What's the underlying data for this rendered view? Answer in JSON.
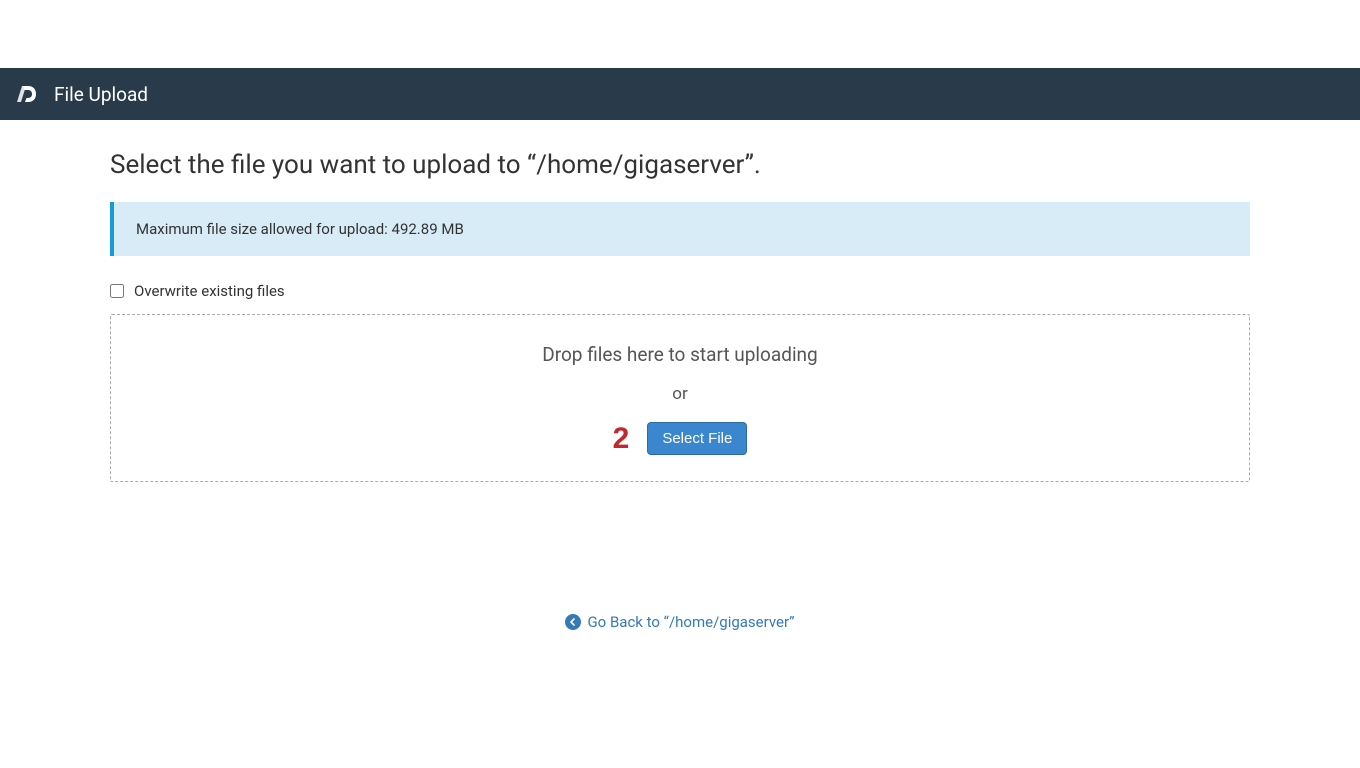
{
  "header": {
    "title": "File Upload"
  },
  "main": {
    "heading": "Select the file you want to upload to “/home/gigaserver”.",
    "info_banner": "Maximum file size allowed for upload: 492.89 MB",
    "overwrite_label": "Overwrite existing files",
    "overwrite_checked": false,
    "dropzone": {
      "drop_text": "Drop files here to start uploading",
      "or_text": "or",
      "step_marker": "2",
      "select_button": "Select File"
    },
    "go_back_label": "Go Back to “/home/gigaserver”"
  },
  "colors": {
    "header_bg": "#293a4a",
    "info_bg": "#d8ecf8",
    "info_border": "#179bd7",
    "button_bg": "#3a87d0",
    "link": "#337ab7",
    "step_marker": "#c1272d"
  }
}
